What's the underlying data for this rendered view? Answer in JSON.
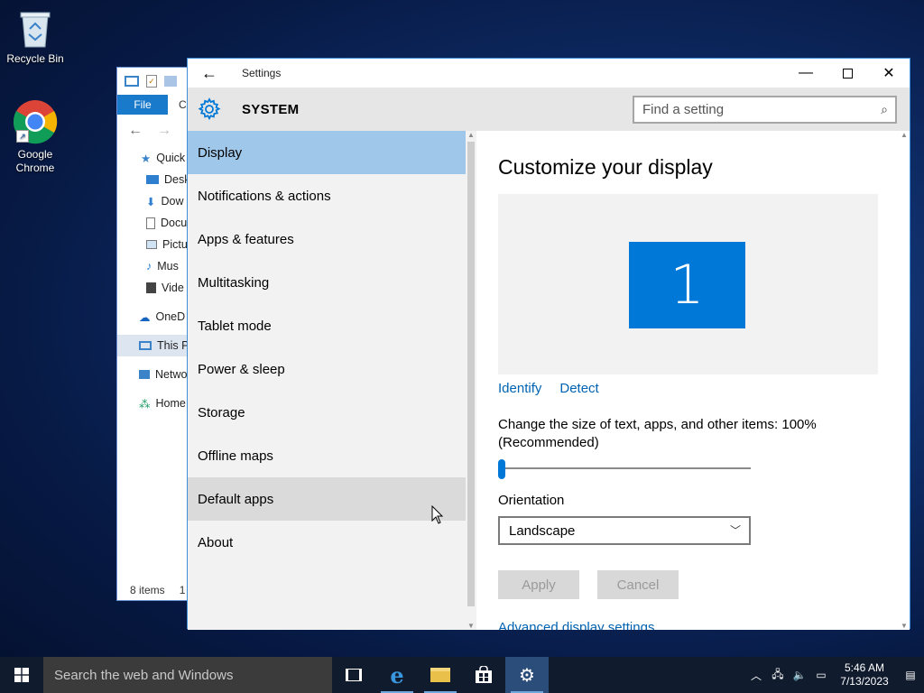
{
  "desktop": {
    "icons": [
      {
        "label": "Recycle Bin"
      },
      {
        "label": "Google Chrome"
      }
    ]
  },
  "explorer": {
    "ribbon_file": "File",
    "ribbon_next": "C",
    "tree": [
      "Quick",
      "Desk",
      "Dow",
      "Docu",
      "Pictu",
      "Mus",
      "Vide",
      "OneD",
      "This P",
      "Netwo",
      "Home"
    ],
    "status": "8 items",
    "status_extra": "1"
  },
  "settings": {
    "window_title": "Settings",
    "header": "SYSTEM",
    "search_placeholder": "Find a setting",
    "nav": [
      "Display",
      "Notifications & actions",
      "Apps & features",
      "Multitasking",
      "Tablet mode",
      "Power & sleep",
      "Storage",
      "Offline maps",
      "Default apps",
      "About"
    ],
    "active_nav": "Display",
    "hover_nav": "Default apps",
    "content": {
      "title": "Customize your display",
      "monitor_number": "1",
      "identify": "Identify",
      "detect": "Detect",
      "scale_label": "Change the size of text, apps, and other items: 100% (Recommended)",
      "scale_value_percent": 100,
      "orientation_label": "Orientation",
      "orientation_value": "Landscape",
      "apply": "Apply",
      "cancel": "Cancel",
      "cutoff_link": "Advanced display settings"
    }
  },
  "taskbar": {
    "search_placeholder": "Search the web and Windows",
    "time": "5:46 AM",
    "date": "7/13/2023"
  },
  "colors": {
    "accent": "#0078d7",
    "nav_active": "#9fc7ea",
    "link": "#0063b1"
  }
}
